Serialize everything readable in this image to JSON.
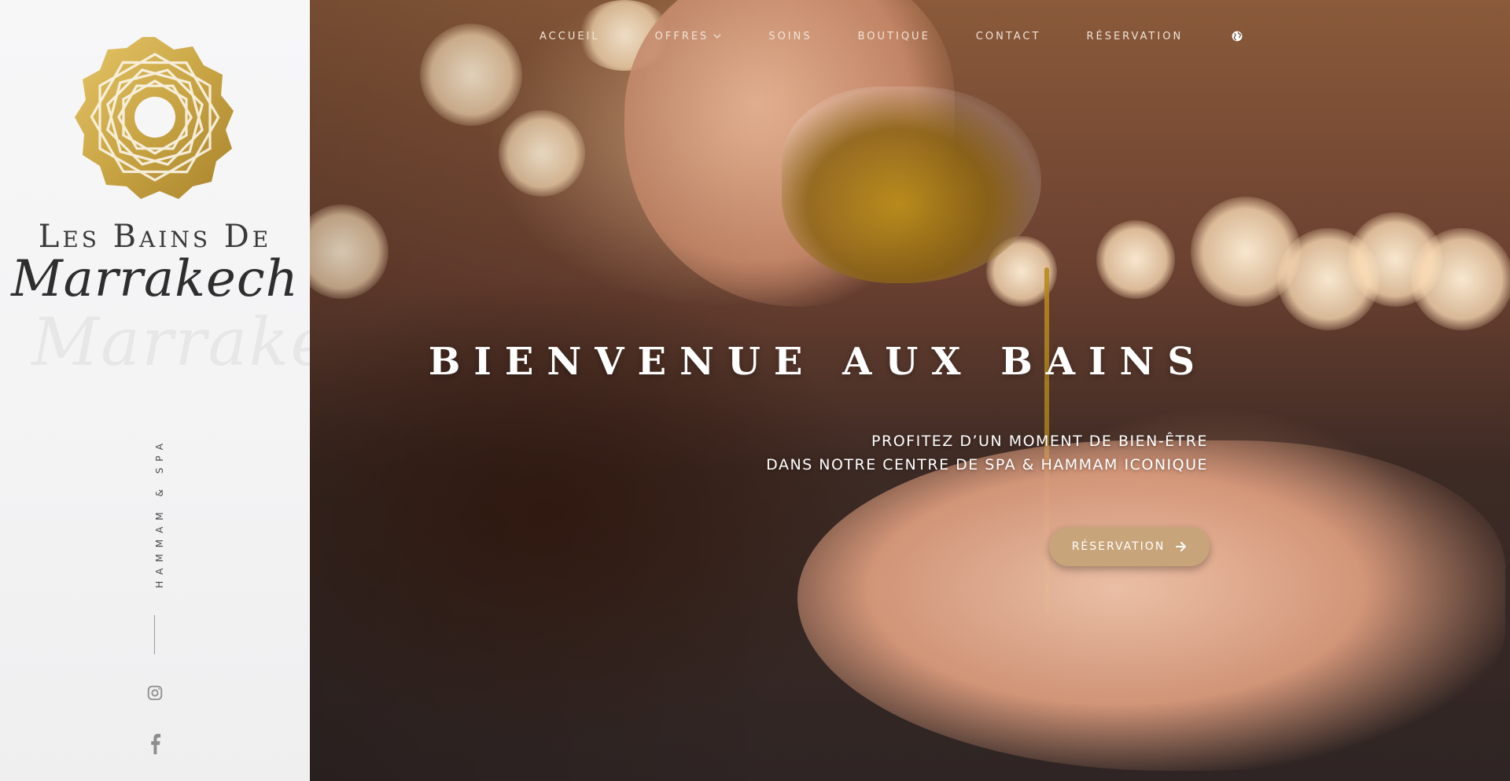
{
  "sidebar": {
    "brand_top": "Les Bains De",
    "brand_script": "Marrakech",
    "tagline": "HAMMAM & SPA",
    "social": [
      "instagram-icon",
      "facebook-icon"
    ]
  },
  "nav": {
    "items": [
      {
        "label": "ACCUEIL"
      },
      {
        "label": "OFFRES",
        "has_dropdown": true
      },
      {
        "label": "SOINS"
      },
      {
        "label": "BOUTIQUE"
      },
      {
        "label": "CONTACT"
      },
      {
        "label": "RÉSERVATION"
      }
    ],
    "language_icon": "globe-icon"
  },
  "hero": {
    "title": "BIENVENUE AUX BAINS",
    "subtitle_line1": "PROFITEZ D’UN MOMENT DE BIEN-ÊTRE",
    "subtitle_line2": "DANS NOTRE CENTRE DE SPA & HAMMAM ICONIQUE",
    "cta_label": "RÉSERVATION",
    "cta_icon": "arrow-right-icon"
  },
  "colors": {
    "accent": "#c8a47a",
    "logo_gold": "#c9a544",
    "sidebar_bg": "#f5f5f6",
    "nav_text": "#f1e4d6"
  }
}
